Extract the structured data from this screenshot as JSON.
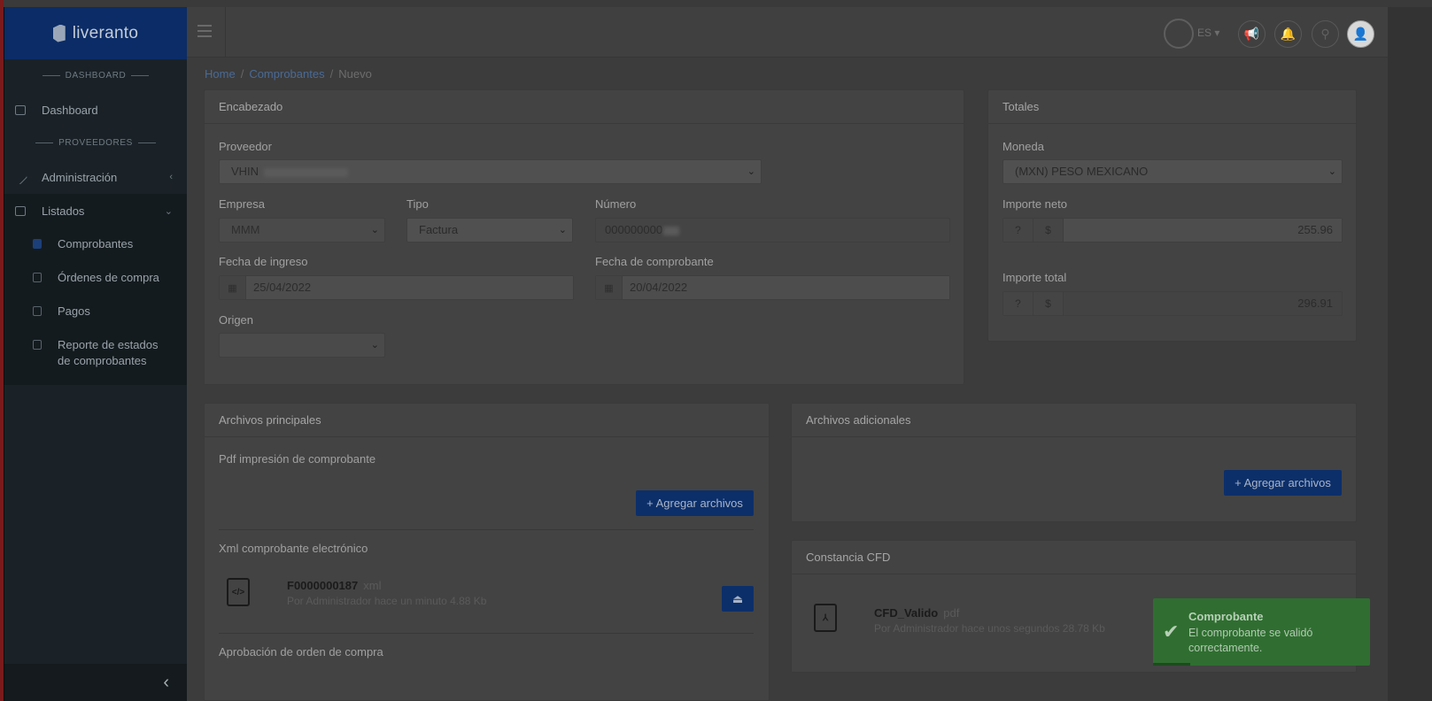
{
  "brand": "liveranto",
  "sidebar": {
    "sections": [
      "DASHBOARD",
      "PROVEEDORES"
    ],
    "items": [
      {
        "label": "Dashboard"
      },
      {
        "label": "Administración"
      },
      {
        "label": "Listados"
      }
    ],
    "subitems": [
      {
        "label": "Comprobantes"
      },
      {
        "label": "Órdenes de compra"
      },
      {
        "label": "Pagos"
      },
      {
        "label": "Reporte de estados de comprobantes"
      }
    ],
    "collapse_icon": "‹"
  },
  "topbar": {
    "language": "ES",
    "icons": [
      "globe-icon",
      "megaphone-icon",
      "bell-icon",
      "help-icon",
      "user-icon"
    ]
  },
  "breadcrumb": [
    "Home",
    "Comprobantes",
    "Nuevo"
  ],
  "encabezado": {
    "title": "Encabezado",
    "proveedor_label": "Proveedor",
    "proveedor_value": "VHIN",
    "empresa_label": "Empresa",
    "empresa_value": "MMM",
    "tipo_label": "Tipo",
    "tipo_value": "Factura",
    "numero_label": "Número",
    "numero_value": "000000000",
    "fecha_ingreso_label": "Fecha de ingreso",
    "fecha_ingreso_value": "25/04/2022",
    "fecha_comprobante_label": "Fecha de comprobante",
    "fecha_comprobante_value": "20/04/2022",
    "origen_label": "Origen",
    "origen_value": ""
  },
  "totales": {
    "title": "Totales",
    "moneda_label": "Moneda",
    "moneda_value": "(MXN) PESO MEXICANO",
    "importe_neto_label": "Importe neto",
    "importe_neto_value": "255.96",
    "importe_total_label": "Importe total",
    "importe_total_value": "296.91",
    "currency_symbol": "$",
    "help_symbol": "?"
  },
  "archivos_principales": {
    "title": "Archivos principales",
    "pdf_label": "Pdf impresión de comprobante",
    "add_button": "+ Agregar archivos",
    "xml_label": "Xml comprobante electrónico",
    "xml_file_name": "F0000000187",
    "xml_file_ext": "xml",
    "xml_file_meta": "Por Administrador hace un minuto  4.88 Kb",
    "aprobacion_label": "Aprobación de orden de compra"
  },
  "archivos_adicionales": {
    "title": "Archivos adicionales",
    "add_button": "+ Agregar archivos"
  },
  "constancia": {
    "title": "Constancia CFD",
    "file_name": "CFD_Valido",
    "file_ext": "pdf",
    "file_meta": "Por Administrador hace unos segundos  28.78 Kb"
  },
  "toast": {
    "title": "Comprobante",
    "message": "El comprobante se validó correctamente."
  }
}
